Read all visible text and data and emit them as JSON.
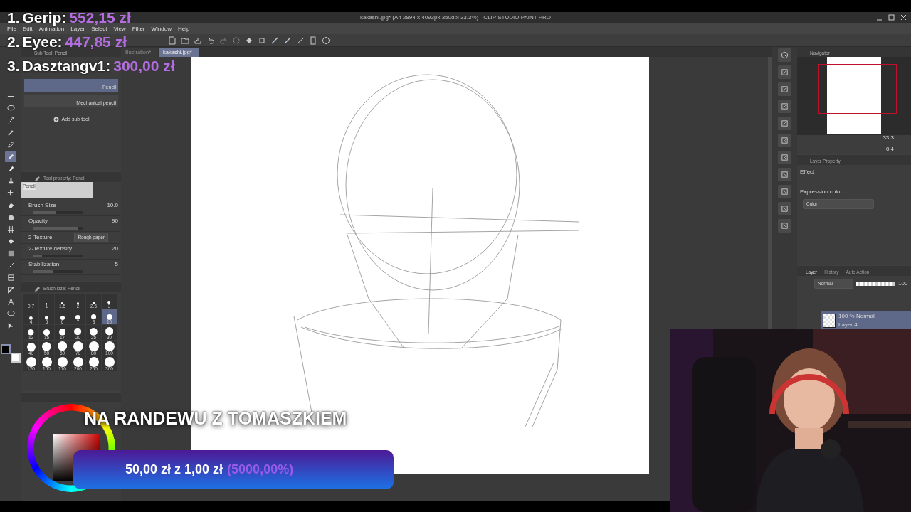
{
  "leaderboard": [
    {
      "rank": "1.",
      "name": "Gerip:",
      "amount": "552,15 zł"
    },
    {
      "rank": "2.",
      "name": "Eyee:",
      "amount": "447,85 zł"
    },
    {
      "rank": "3.",
      "name": "Dasztangv1:",
      "amount": "300,00 zł"
    }
  ],
  "window": {
    "title": "kakashi.jpg* (A4 2894 x 4093px 350dpi 33.3%)  - CLIP STUDIO PAINT PRO"
  },
  "menu": [
    "File",
    "Edit",
    "Animation",
    "Layer",
    "Select",
    "View",
    "Filter",
    "Window",
    "Help"
  ],
  "document_tabs": [
    {
      "label": "Illustration*",
      "selected": false
    },
    {
      "label": "kakashi.jpg*",
      "selected": true
    }
  ],
  "tools": [
    {
      "kind": "move",
      "selected": false
    },
    {
      "kind": "lasso",
      "selected": false
    },
    {
      "kind": "wand",
      "selected": false
    },
    {
      "kind": "eyedropper",
      "selected": false
    },
    {
      "kind": "pen",
      "selected": false
    },
    {
      "kind": "pencil",
      "selected": true
    },
    {
      "kind": "brush",
      "selected": false
    },
    {
      "kind": "stamp",
      "selected": false
    },
    {
      "kind": "sparkle",
      "selected": false
    },
    {
      "kind": "eraser",
      "selected": false
    },
    {
      "kind": "blend",
      "selected": false
    },
    {
      "kind": "grid",
      "selected": false
    },
    {
      "kind": "fill",
      "selected": false
    },
    {
      "kind": "gradient",
      "selected": false
    },
    {
      "kind": "line",
      "selected": false
    },
    {
      "kind": "frame",
      "selected": false
    },
    {
      "kind": "ruler",
      "selected": false
    },
    {
      "kind": "text",
      "selected": false
    },
    {
      "kind": "balloon",
      "selected": false
    },
    {
      "kind": "pointer",
      "selected": false
    }
  ],
  "sub_tool": {
    "title": "Sub Tool: Pencil",
    "items": [
      {
        "label": "Pencil",
        "selected": true
      },
      {
        "label": "Mechanical pencil",
        "selected": false
      }
    ],
    "add_label": "Add sub tool"
  },
  "tool_property": {
    "title": "Tool property: Pencil",
    "preview_label": "Pencil",
    "rows": [
      {
        "kind": "slider",
        "label": "Brush Size",
        "value": "10.0",
        "level": 0.45
      },
      {
        "kind": "slider",
        "label": "Opacity",
        "value": "90",
        "level": 0.9
      },
      {
        "kind": "choice",
        "label": "2-Texture",
        "value": "Rough paper"
      },
      {
        "kind": "slider",
        "label": "2-Texture density",
        "value": "20",
        "level": 0.18
      },
      {
        "kind": "slider",
        "label": "Stabilization",
        "value": "5",
        "level": 0.4
      }
    ]
  },
  "brush_sizes": {
    "title": "Brush size: Pencil",
    "sizes": [
      {
        "label": "0.7",
        "selected": false
      },
      {
        "label": "1",
        "selected": false
      },
      {
        "label": "1.5",
        "selected": false
      },
      {
        "label": "2",
        "selected": false
      },
      {
        "label": "2.5",
        "selected": false
      },
      {
        "label": "3",
        "selected": false
      },
      {
        "label": "4",
        "selected": false
      },
      {
        "label": "5",
        "selected": false
      },
      {
        "label": "6",
        "selected": false
      },
      {
        "label": "7",
        "selected": false
      },
      {
        "label": "8",
        "selected": false
      },
      {
        "label": "10",
        "selected": true
      },
      {
        "label": "12",
        "selected": false
      },
      {
        "label": "15",
        "selected": false
      },
      {
        "label": "17",
        "selected": false
      },
      {
        "label": "20",
        "selected": false
      },
      {
        "label": "25",
        "selected": false
      },
      {
        "label": "30",
        "selected": false
      },
      {
        "label": "40",
        "selected": false
      },
      {
        "label": "50",
        "selected": false
      },
      {
        "label": "60",
        "selected": false
      },
      {
        "label": "70",
        "selected": false
      },
      {
        "label": "80",
        "selected": false
      },
      {
        "label": "100",
        "selected": false
      },
      {
        "label": "120",
        "selected": false
      },
      {
        "label": "150",
        "selected": false
      },
      {
        "label": "170",
        "selected": false
      },
      {
        "label": "200",
        "selected": false
      },
      {
        "label": "250",
        "selected": false
      },
      {
        "label": "300",
        "selected": false
      }
    ]
  },
  "navigator": {
    "title": "Navigator",
    "zoom": "33.3",
    "rotation": "0.4"
  },
  "layer_property": {
    "title": "Layer Property",
    "effect_label": "Effect",
    "expression_label": "Expression color",
    "expression_value": "Color"
  },
  "layers_panel": {
    "tabs": [
      {
        "label": "Layer",
        "selected": true
      },
      {
        "label": "History",
        "selected": false
      },
      {
        "label": "Auto Action",
        "selected": false
      }
    ],
    "blend_mode": "Normal",
    "opacity": "100",
    "opacity_slider": {
      "level": 1
    },
    "layers": [
      {
        "mode": "100 % Normal",
        "name": "Layer 4",
        "selected": true
      }
    ]
  },
  "stream_title": "NA RANDEWU Z TOMASZKIEM",
  "goal": {
    "text": "50,00 zł z 1,00 zł",
    "percent": "(5000,00%)",
    "level": 1
  }
}
